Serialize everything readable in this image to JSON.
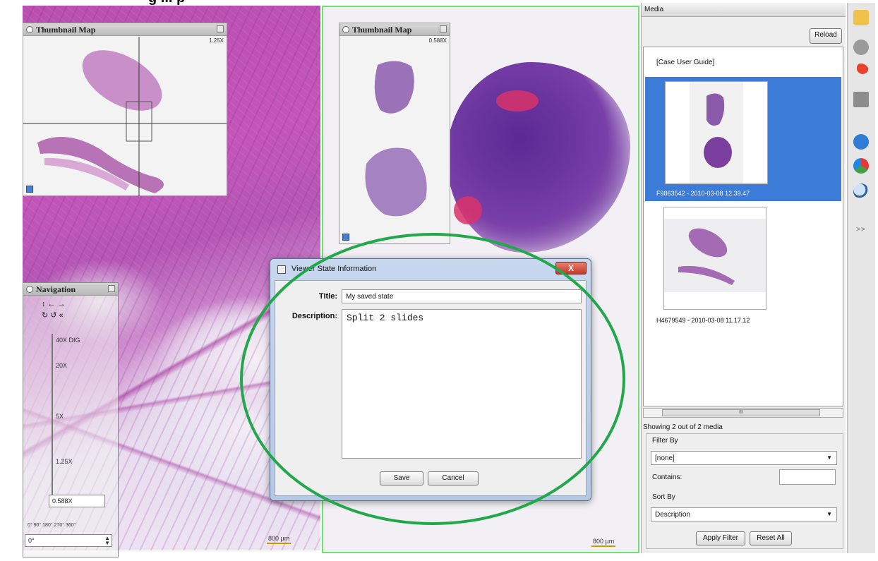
{
  "heading": {
    "text": "g ... p"
  },
  "left_viewer": {
    "thumbnail": {
      "title": "Thumbnail Map",
      "zoom": "1.25X"
    },
    "scalebar": "800 µm",
    "navigation": {
      "title": "Navigation",
      "zoom_levels": [
        "40X DIG",
        "20X",
        "5X",
        "1.25X"
      ],
      "zoom_value": "0.588X",
      "rotation_ticks": "0°  90°  180° 270° 360°",
      "rotation_value": "0°"
    }
  },
  "right_viewer": {
    "thumbnail": {
      "title": "Thumbnail Map",
      "zoom": "0.588X"
    },
    "scalebar": "800 µm"
  },
  "dialog": {
    "title": "Viewer State Information",
    "close_glyph": "X",
    "title_label": "Title:",
    "title_value": "My saved state",
    "description_label": "Description:",
    "description_value": "Split 2 slides",
    "save_label": "Save",
    "cancel_label": "Cancel"
  },
  "annotation": {
    "color": "#22a84b"
  },
  "media": {
    "header": "Media",
    "reload_label": "Reload",
    "case_guide": "[Case User Guide]",
    "items": [
      {
        "caption": "F9863542 - 2010-03-08 12.39.47",
        "selected": true
      },
      {
        "caption": "H4679549 - 2010-03-08 11.17.12",
        "selected": false
      }
    ],
    "scroll_label": "III",
    "showing": "Showing 2 out of 2 media",
    "filter_by_label": "Filter By",
    "filter_value": "[none]",
    "contains_label": "Contains:",
    "sort_by_label": "Sort By",
    "sort_value": "Description",
    "apply_filter_label": "Apply Filter",
    "reset_all_label": "Reset All",
    "selection_color": "#3d7bd9"
  },
  "toolbar": {
    "icons": [
      "folder-icon",
      "disk-icon",
      "pin-icon",
      "box-icon",
      "info-icon",
      "color-icon",
      "magnifier-icon"
    ],
    "expand": ">>"
  }
}
